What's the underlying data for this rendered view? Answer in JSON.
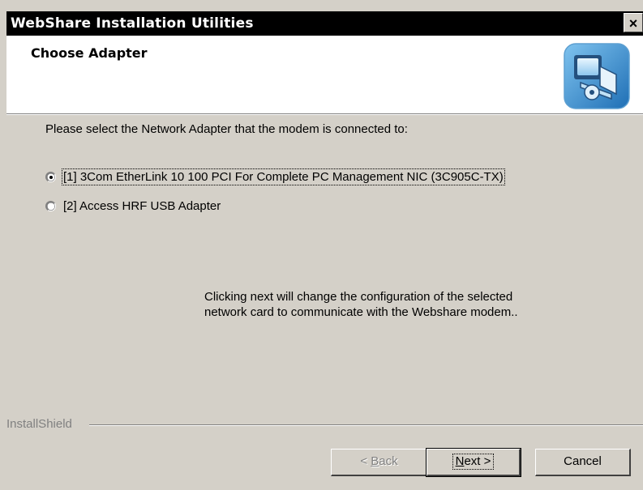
{
  "window": {
    "title": "WebShare Installation Utilities",
    "close_glyph": "×"
  },
  "header": {
    "title": "Choose Adapter",
    "icon": "computer-setup-icon"
  },
  "content": {
    "prompt": "Please select the Network Adapter that the modem is connected to:",
    "adapters": [
      {
        "label": "[1] 3Com EtherLink 10 100 PCI For Complete PC Management NIC (3C905C-TX)",
        "selected": true
      },
      {
        "label": "[2] Access HRF USB Adapter",
        "selected": false
      }
    ],
    "info_line1": "Clicking next will change the configuration of the selected",
    "info_line2": "network card to communicate with the Webshare modem.."
  },
  "footer": {
    "brand": "InstallShield",
    "back_mnemonic": "B",
    "back_rest": "ack",
    "back_prefix": "< ",
    "next_mnemonic": "N",
    "next_rest": "ext >",
    "cancel_label": "Cancel"
  },
  "colors": {
    "title_bg": "#000000",
    "dialog_bg": "#d4d0c8",
    "header_bg": "#ffffff"
  }
}
